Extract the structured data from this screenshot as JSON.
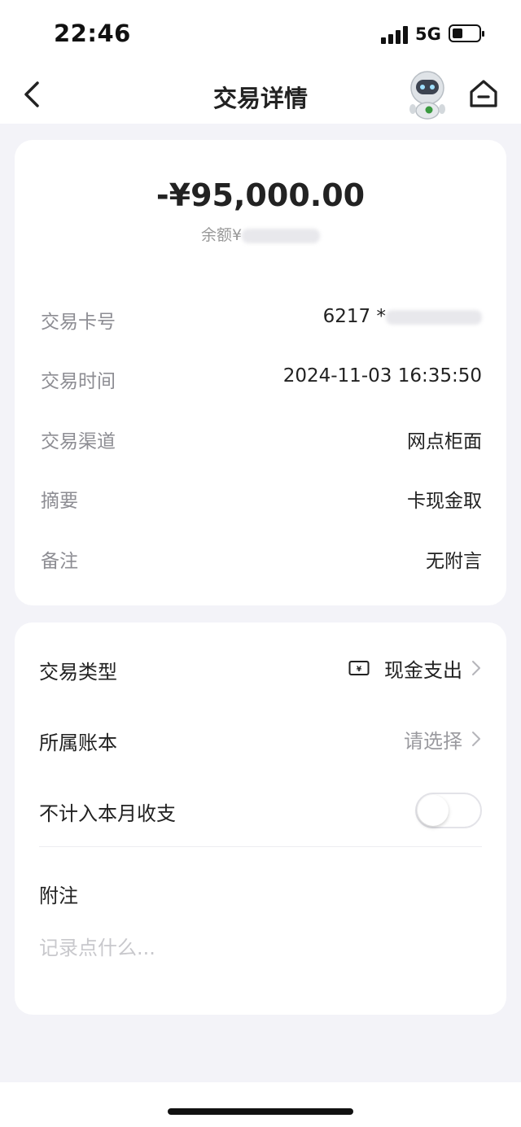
{
  "status": {
    "time": "22:46",
    "network": "5G"
  },
  "nav": {
    "title": "交易详情"
  },
  "summary": {
    "amount": "-¥95,000.00",
    "balance_label": "余额¥"
  },
  "details": [
    {
      "label": "交易卡号",
      "value": "6217 *"
    },
    {
      "label": "交易时间",
      "value": "2024-11-03 16:35:50"
    },
    {
      "label": "交易渠道",
      "value": "网点柜面"
    },
    {
      "label": "摘要",
      "value": "卡现金取"
    },
    {
      "label": "备注",
      "value": "无附言"
    }
  ],
  "options": {
    "type": {
      "label": "交易类型",
      "value": "现金支出",
      "icon": "cash-icon"
    },
    "book": {
      "label": "所属账本",
      "value": "请选择"
    },
    "exclude": {
      "label": "不计入本月收支",
      "enabled": false
    },
    "note": {
      "label": "附注",
      "placeholder": "记录点什么..."
    }
  }
}
